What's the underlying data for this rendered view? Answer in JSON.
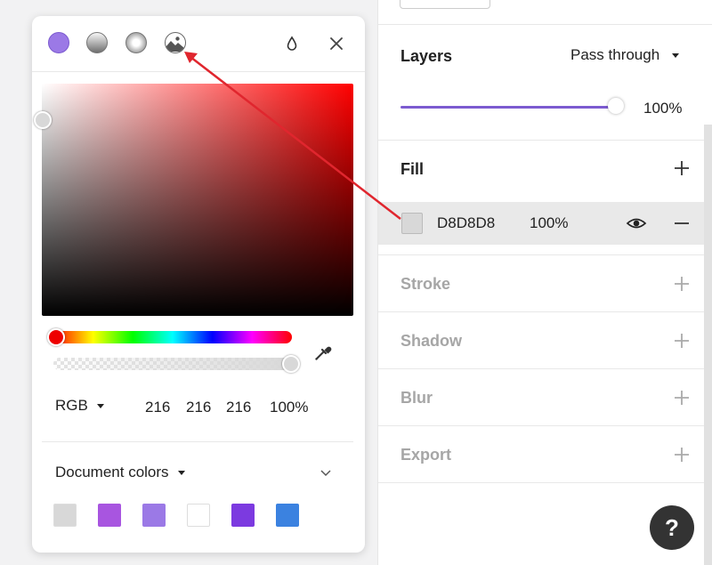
{
  "picker": {
    "fill_types": [
      {
        "icon": "solid-fill-icon"
      },
      {
        "icon": "linear-gradient-icon"
      },
      {
        "icon": "radial-gradient-icon"
      },
      {
        "icon": "image-fill-icon"
      }
    ],
    "color_mode": "RGB",
    "rgba": {
      "r": "216",
      "g": "216",
      "b": "216",
      "a": "100%"
    },
    "document_colors_label": "Document colors",
    "document_colors": [
      "#d8d8d8",
      "#a855e0",
      "#9b79e6",
      "#ffffff",
      "#7c3ae0",
      "#3b82e0"
    ]
  },
  "panel": {
    "layers": {
      "title": "Layers",
      "blend_mode": "Pass through",
      "opacity": "100%",
      "opacity_fraction": 1.0
    },
    "fill": {
      "title": "Fill",
      "hex": "D8D8D8",
      "opacity": "100%",
      "color": "#d8d8d8"
    },
    "sections": [
      "Stroke",
      "Shadow",
      "Blur",
      "Export"
    ],
    "help_label": "?"
  },
  "colors": {
    "accent": "#7c5bd0",
    "annotation_arrow": "#e0262e",
    "current_color": "#d8d8d8"
  }
}
